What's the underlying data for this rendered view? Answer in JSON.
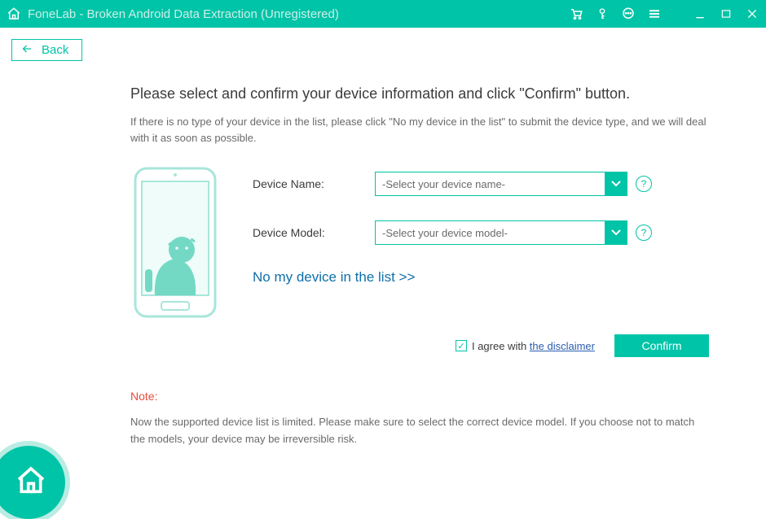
{
  "titlebar": {
    "title": "FoneLab - Broken Android Data Extraction (Unregistered)"
  },
  "back_button": "Back",
  "heading": "Please select and confirm your device information and click \"Confirm\" button.",
  "subtext": "If there is no type of your device in the list, please click \"No my device in the list\" to submit the device type, and we will deal with it as soon as possible.",
  "fields": {
    "device_name_label": "Device Name:",
    "device_name_value": "-Select your device name-",
    "device_model_label": "Device Model:",
    "device_model_value": "-Select your device model-"
  },
  "no_device_link": "No my device in the list >>",
  "agree": {
    "prefix": "I agree with ",
    "link": "the disclaimer"
  },
  "confirm_button": "Confirm",
  "note": {
    "label": "Note:",
    "text": "Now the supported device list is limited. Please make sure to select the correct device model. If you choose not to match the models, your device may be irreversible risk."
  },
  "help_char": "?"
}
